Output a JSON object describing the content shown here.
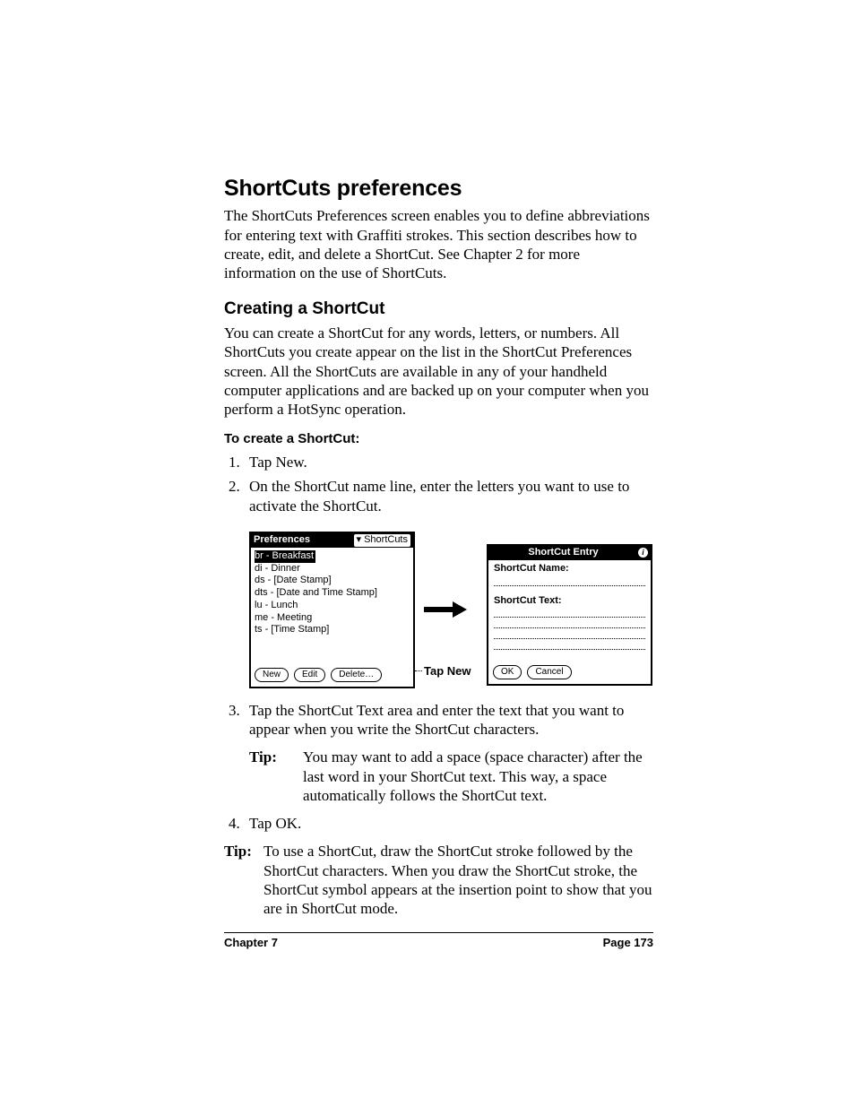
{
  "heading": "ShortCuts preferences",
  "intro": "The ShortCuts Preferences screen enables you to define abbreviations for entering text with Graffiti strokes. This section describes how to create, edit, and delete a ShortCut. See Chapter 2 for more information on the use of ShortCuts.",
  "section2_heading": "Creating a ShortCut",
  "section2_body": "You can create a ShortCut for any words, letters, or numbers. All ShortCuts you create appear on the list in the ShortCut Preferences screen. All the ShortCuts are available in any of your handheld computer applications and are backed up on your computer when you perform a HotSync operation.",
  "proc_heading": "To create a ShortCut:",
  "steps": {
    "s1": "Tap New.",
    "s2": "On the ShortCut name line, enter the letters you want to use to activate the ShortCut.",
    "s3": "Tap the ShortCut Text area and enter the text that you want to appear when you write the ShortCut characters.",
    "s4": "Tap OK."
  },
  "tip1_label": "Tip:",
  "tip1_body": "You may want to add a space (space character) after the last word in your ShortCut text. This way, a space automatically follows the ShortCut text.",
  "tip2_label": "Tip:",
  "tip2_body": "To use a ShortCut, draw the ShortCut stroke followed by the ShortCut characters. When you draw the ShortCut stroke, the ShortCut symbol appears at the insertion point to show that you are in ShortCut mode.",
  "fig_callout": "Tap New",
  "screen1": {
    "title": "Preferences",
    "menu": "ShortCuts",
    "items": {
      "i0": "br - Breakfast",
      "i1": "di - Dinner",
      "i2": "ds - [Date Stamp]",
      "i3": "dts - [Date and Time Stamp]",
      "i4": "lu - Lunch",
      "i5": "me - Meeting",
      "i6": "ts - [Time Stamp]"
    },
    "buttons": {
      "new": "New",
      "edit": "Edit",
      "delete": "Delete…"
    }
  },
  "screen2": {
    "title": "ShortCut Entry",
    "name_label": "ShortCut Name:",
    "text_label": "ShortCut Text:",
    "buttons": {
      "ok": "OK",
      "cancel": "Cancel"
    }
  },
  "footer": {
    "chapter": "Chapter 7",
    "page": "Page 173"
  }
}
